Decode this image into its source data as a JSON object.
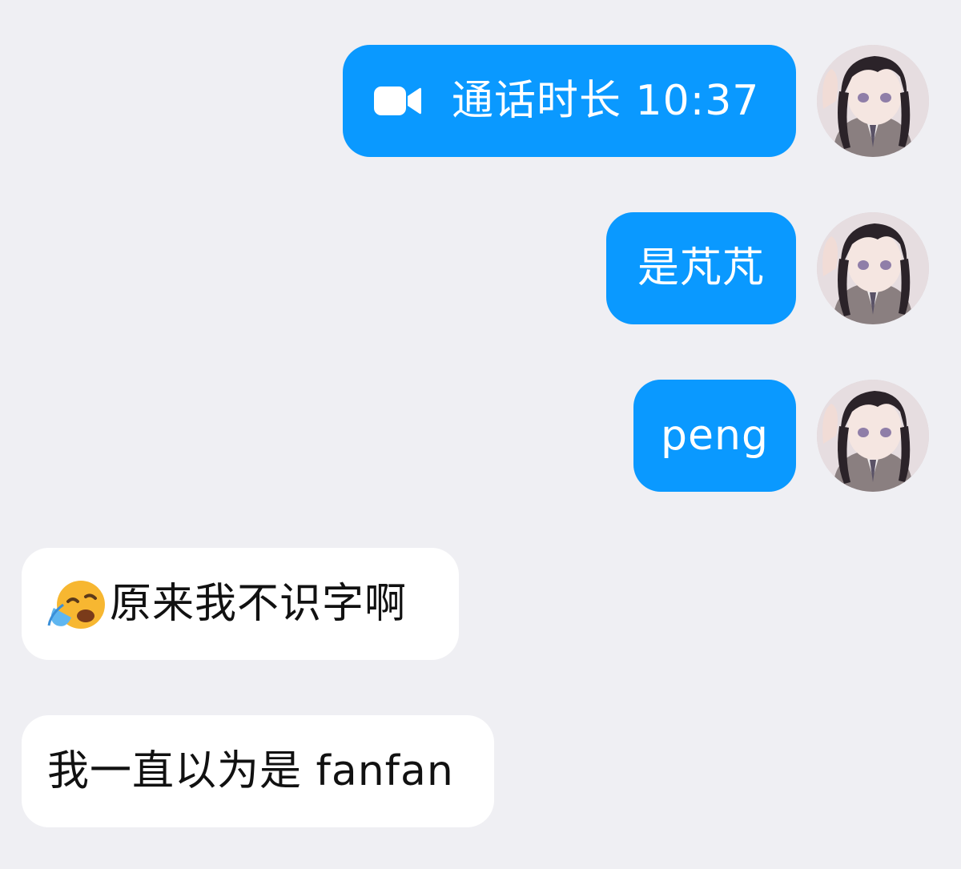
{
  "messages": {
    "call": {
      "icon": "video-camera-icon",
      "text": "通话时长 10:37"
    },
    "sent_2": {
      "text": "是芃芃"
    },
    "sent_3": {
      "text": "peng"
    },
    "recv_1": {
      "emoji": "loudly-crying-face-icon",
      "text": "原来我不识字啊"
    },
    "recv_2": {
      "text": "我一直以为是 fanfan"
    }
  },
  "colors": {
    "background": "#efeff3",
    "outgoing_bubble": "#0a99ff",
    "incoming_bubble": "#ffffff",
    "outgoing_text": "#ffffff",
    "incoming_text": "#111111"
  }
}
